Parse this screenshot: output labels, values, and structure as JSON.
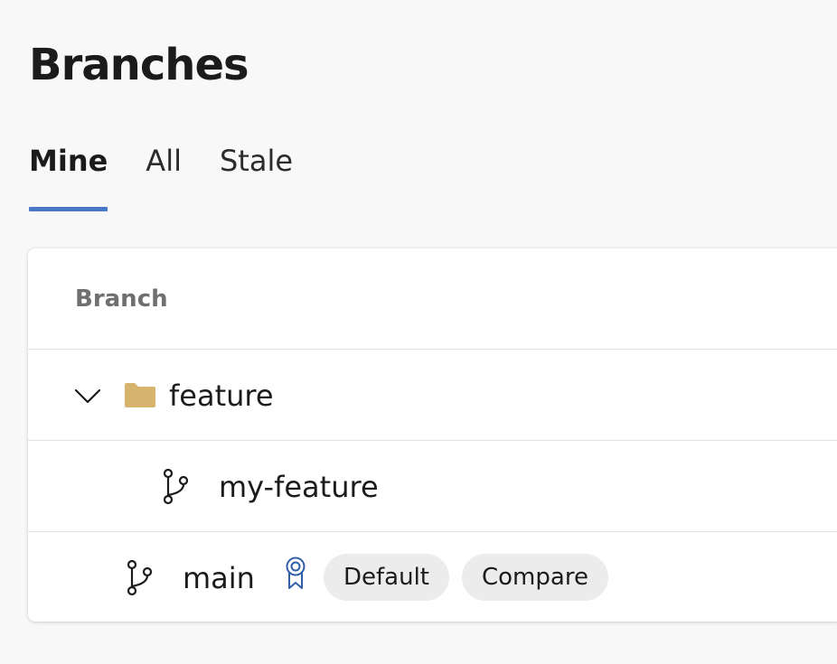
{
  "header": {
    "title": "Branches"
  },
  "tabs": [
    {
      "label": "Mine",
      "selected": true
    },
    {
      "label": "All",
      "selected": false
    },
    {
      "label": "Stale",
      "selected": false
    }
  ],
  "table": {
    "column_header": "Branch",
    "rows": [
      {
        "type": "folder",
        "name": "feature",
        "expanded": true,
        "icons": [
          "chevron-down-icon",
          "folder-icon"
        ]
      },
      {
        "type": "branch",
        "name": "my-feature",
        "icons": [
          "branch-icon"
        ]
      },
      {
        "type": "branch",
        "name": "main",
        "icons": [
          "branch-icon",
          "default-badge-icon"
        ],
        "actions": [
          "Default",
          "Compare"
        ]
      }
    ]
  },
  "colors": {
    "accent": "#4a78c8",
    "folder": "#d6b46e",
    "badge_icon": "#2f5fa8",
    "pill_bg": "#ececec",
    "page_bg": "#f8f8f8"
  }
}
